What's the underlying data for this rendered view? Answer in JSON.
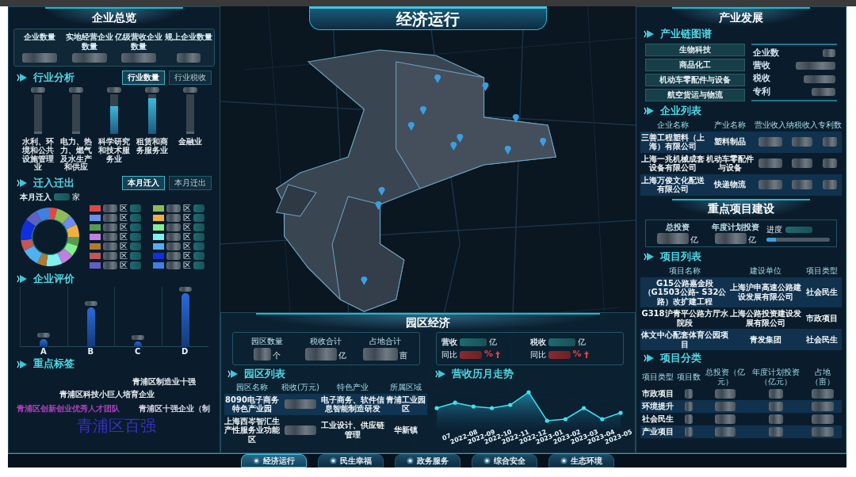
{
  "header": {
    "title": "经济运行"
  },
  "overview": {
    "title": "企业总览",
    "stats": [
      {
        "label": "企业数量"
      },
      {
        "label": "实地经营企业数量"
      },
      {
        "label": "亿级营收企业数量"
      },
      {
        "label": "规上企业数量"
      }
    ]
  },
  "industry": {
    "title": "行业分析",
    "tabs": [
      {
        "label": "行业数量",
        "selected": true
      },
      {
        "label": "行业税收",
        "selected": false
      }
    ],
    "categories": [
      "水利、环境和公共设施管理业",
      "电力、热力、燃气及水生产和供应",
      "科学研究和技术服务业",
      "租赁和商务服务业",
      "金融业"
    ]
  },
  "migration": {
    "title": "迁入迁出",
    "tabs": [
      {
        "label": "本月迁入",
        "selected": true
      },
      {
        "label": "本月迁出",
        "selected": false
      }
    ],
    "summary": {
      "label": "本月迁入",
      "unit": "家"
    },
    "legend": [
      {
        "color": "#e04848",
        "label": "区"
      },
      {
        "color": "#8fba5a",
        "label": "区"
      },
      {
        "color": "#6c8cf0",
        "label": "区"
      },
      {
        "color": "#f0b040",
        "label": "区"
      },
      {
        "color": "#5a9a50",
        "label": "区"
      },
      {
        "color": "#80f090",
        "label": "区"
      },
      {
        "color": "#c080e0",
        "label": "区"
      },
      {
        "color": "#80f0f0",
        "label": "区"
      },
      {
        "color": "#b07a30",
        "label": "区"
      },
      {
        "color": "#50b0f0",
        "label": "区"
      },
      {
        "color": "#c05858",
        "label": "区"
      },
      {
        "color": "#1030e0",
        "label": "区"
      },
      {
        "color": "#6060c0",
        "label": "区"
      },
      {
        "color": "#4080e0",
        "label": "区"
      }
    ]
  },
  "evaluation": {
    "title": "企业评价",
    "categories": [
      "A",
      "B",
      "C",
      "D"
    ]
  },
  "tags": {
    "title": "重点标签",
    "items": [
      {
        "text": "青浦区制造业十强",
        "color": "#e8eef2",
        "kind": "small"
      },
      {
        "text": "青浦区科技小巨人培育企业",
        "color": "#e8eef2",
        "kind": "small"
      },
      {
        "text": "青浦区创新创业优秀人才团队",
        "color": "#b040c0",
        "kind": "small"
      },
      {
        "text": "青浦区十强企业（制",
        "color": "#d8d8ea",
        "kind": "small"
      },
      {
        "text": "青浦区百强",
        "color": "#3a2ec8",
        "kind": "large"
      }
    ]
  },
  "park": {
    "title": "园区经济",
    "stats": [
      {
        "label": "园区数量",
        "unit": "个"
      },
      {
        "label": "税收合计",
        "unit": "亿"
      },
      {
        "label": "占地合计",
        "unit": "亩"
      }
    ],
    "growth": [
      {
        "label": "营收",
        "unit": "亿",
        "compare": {
          "label": "同比",
          "unit": "%"
        }
      },
      {
        "label": "税收",
        "unit": "亿",
        "compare": {
          "label": "同比",
          "unit": "%"
        }
      }
    ],
    "list": {
      "title": "园区列表",
      "columns": [
        "园区名称",
        "税收(万元)",
        "特色产业",
        "所属区域"
      ],
      "rows": [
        {
          "name": "8090电子商务特色产业园",
          "industry": "电子商务、软件信息智能制造研发",
          "area": "青浦工业园区"
        },
        {
          "name": "上海西岑智汇生产性服务业功能区",
          "industry": "工业设计、供应链管理",
          "area": "华新镇"
        }
      ]
    },
    "trend": {
      "title": "营收历月走势",
      "months": [
        "07",
        "2022-08",
        "2022-09",
        "2022-10",
        "2022-11",
        "2022-12",
        "2023-01",
        "2023-02",
        "2023-03",
        "2023-04",
        "2023-05"
      ]
    }
  },
  "industry_development": {
    "title": "产业发展",
    "chain": {
      "title": "产业链图谱",
      "items": [
        "生物科技",
        "商品化工",
        "机动车零配件与设备",
        "航空货运与物流"
      ],
      "metrics": [
        "企业数",
        "营收",
        "税收",
        "专利"
      ]
    },
    "companies": {
      "title": "企业列表",
      "columns": [
        "企业名称",
        "产业名称",
        "营业收入",
        "纳税收入",
        "专利数"
      ],
      "rows": [
        {
          "name": "三善工程塑料（上海）有限公司",
          "industry": "塑料制品"
        },
        {
          "name": "上海一兆机械成套设备有限公司",
          "industry": "机动车零配件与设备"
        },
        {
          "name": "上海万俊文化配送有限公司",
          "industry": "快递物流"
        }
      ]
    }
  },
  "key_projects": {
    "title": "重点项目建设",
    "stats": [
      {
        "label": "总投资",
        "unit": "亿"
      },
      {
        "label": "年度计划投资",
        "unit": "亿"
      }
    ],
    "progress": {
      "label": "进度",
      "level": 0.15
    },
    "list": {
      "title": "项目列表",
      "columns": [
        "项目名称",
        "建设单位",
        "项目类型"
      ],
      "rows": [
        {
          "name": "G15公路嘉金段（G1503公路- S32公路）改扩建工程",
          "builder": "上海沪申高速公路建设发展有限公司",
          "type": "社会民生"
        },
        {
          "name": "G318沪青平公路方厅水院段",
          "builder": "上海公路投资建设发展有限公司",
          "type": "市政项目"
        },
        {
          "name": "体文中心配套体育公园项目",
          "builder": "青发集团",
          "type": "社会民生"
        }
      ]
    },
    "categories": {
      "title": "项目分类",
      "columns": [
        "项目类型",
        "项目数",
        "总投资（亿元）",
        "年度计划投资（亿元）",
        "占地（亩）"
      ],
      "rows": [
        "市政项目",
        "环境提升",
        "社会民生",
        "产业项目"
      ]
    }
  },
  "nav": [
    {
      "label": "经济运行",
      "selected": true
    },
    {
      "label": "民生幸福",
      "selected": false
    },
    {
      "label": "政务服务",
      "selected": false
    },
    {
      "label": "综合安全",
      "selected": false
    },
    {
      "label": "生态环境",
      "selected": false
    }
  ]
}
